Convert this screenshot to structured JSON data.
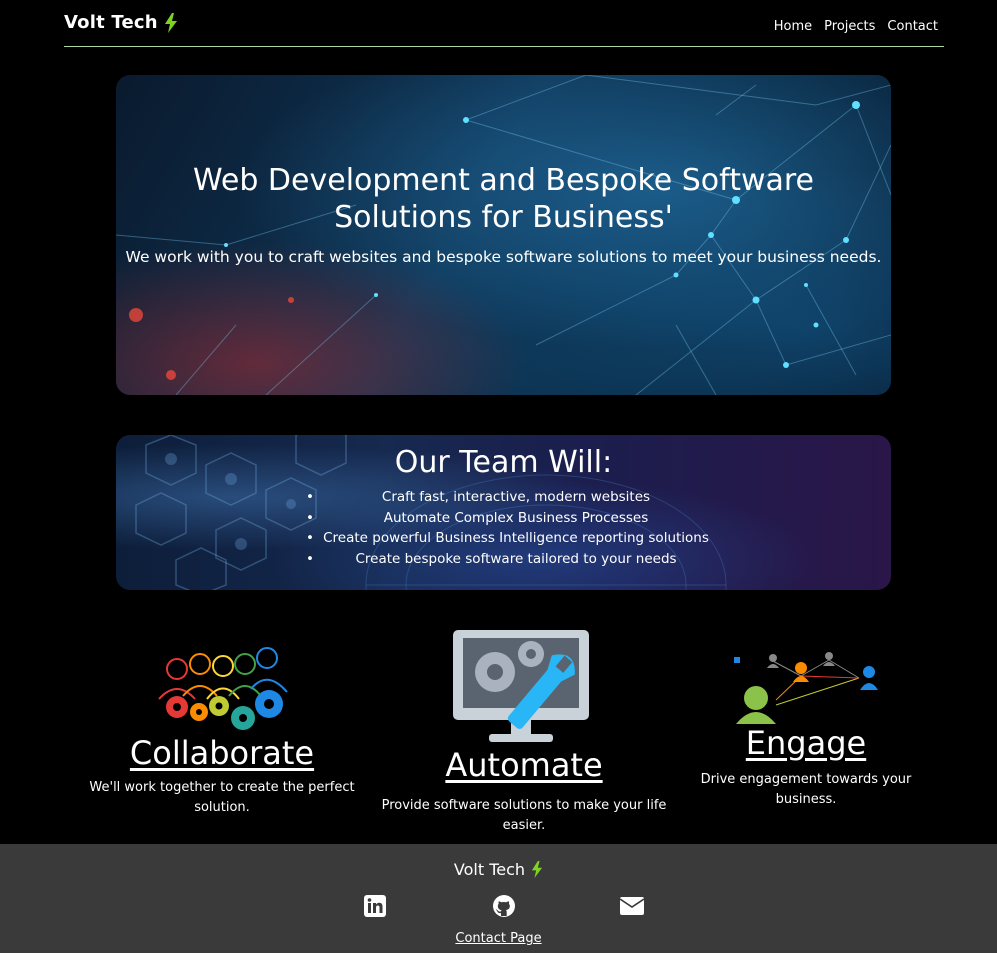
{
  "header": {
    "brand": "Volt Tech",
    "nav": [
      "Home",
      "Projects",
      "Contact"
    ]
  },
  "hero": {
    "title": "Web Development and Bespoke Software Solutions for Business'",
    "subtitle": "We work with you to craft websites and bespoke software solutions to meet your business needs."
  },
  "team": {
    "title": "Our Team Will:",
    "items": [
      "Craft fast, interactive, modern websites",
      "Automate Complex Business Processes",
      "Create powerful Business Intelligence reporting solutions",
      "Create bespoke software tailored to your needs"
    ]
  },
  "features": [
    {
      "title": "Collaborate",
      "text": "We'll work together to create the perfect solution.",
      "icon": "collaborate-gears-icon"
    },
    {
      "title": "Automate",
      "text": "Provide software solutions to make your life easier.",
      "icon": "automate-monitor-icon"
    },
    {
      "title": "Engage",
      "text": "Drive engagement towards your business.",
      "icon": "engage-network-icon"
    }
  ],
  "footer": {
    "brand": "Volt Tech",
    "social": [
      "linkedin-icon",
      "github-icon",
      "mail-icon"
    ],
    "contact_link": "Contact Page"
  },
  "colors": {
    "background": "#000000",
    "accent_bolt": "#7ed321",
    "header_rule": "#a8d8a0",
    "footer_bg": "#3a3a3a"
  }
}
